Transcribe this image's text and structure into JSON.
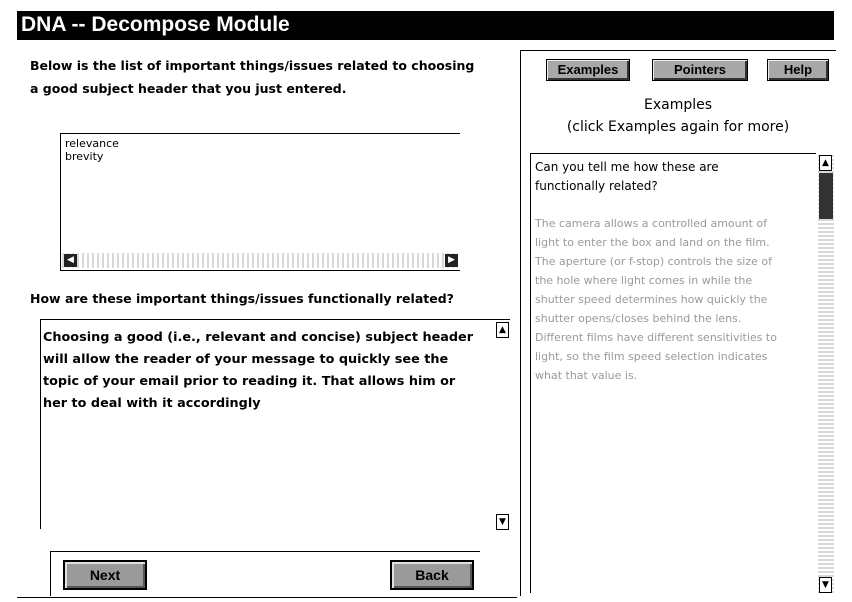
{
  "window": {
    "title": "DNA -- Decompose Module"
  },
  "instructions": "Below is the list of important things/issues related to choosing a good subject header that you just entered.",
  "issues_list": [
    "relevance",
    "brevity"
  ],
  "question": "How are these important things/issues functionally related?",
  "answer_text": "Choosing a good (i.e., relevant and concise) subject header will allow the reader of your message to quickly see the topic of your email prior to reading it. That allows him or her to deal with it accordingly",
  "buttons": {
    "next": "Next",
    "back": "Back"
  },
  "tabs": {
    "examples": "Examples",
    "pointers": "Pointers",
    "help": "Help"
  },
  "examples_panel": {
    "title": "Examples",
    "subtitle": "(click Examples again for more)",
    "prompt": "Can you tell me how these are functionally related?",
    "body": "The camera allows a controlled amount of light to enter the box and land on the film. The aperture (or f-stop) controls the size of the hole where light comes in while the shutter speed determines how quickly the shutter opens/closes behind the lens. Different films have different sensitivities to light, so the film speed selection indicates what that value is."
  },
  "icons": {
    "scroll_left": "arrow-left-icon",
    "scroll_right": "arrow-right-icon",
    "scroll_up": "arrow-up-icon",
    "scroll_down": "arrow-down-icon"
  }
}
